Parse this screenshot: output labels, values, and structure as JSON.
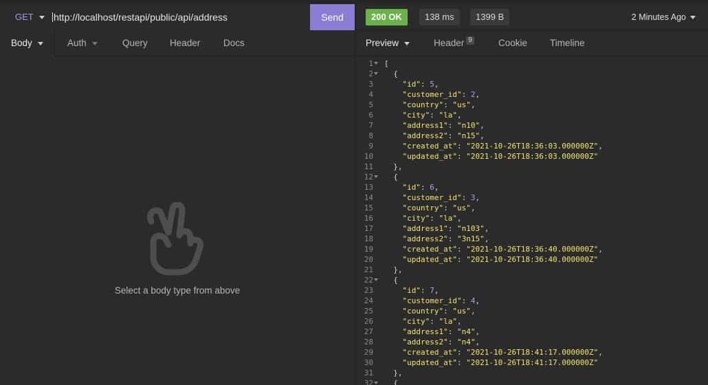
{
  "request": {
    "method": "GET",
    "url": "http://localhost/restapi/public/api/address",
    "send_label": "Send"
  },
  "response_meta": {
    "status": "200 OK",
    "time": "138 ms",
    "size": "1399 B",
    "ago": "2 Minutes Ago"
  },
  "left_tabs": {
    "body": "Body",
    "auth": "Auth",
    "query": "Query",
    "header": "Header",
    "docs": "Docs"
  },
  "left_body": {
    "empty_text": "Select a body type from above"
  },
  "right_tabs": {
    "preview": "Preview",
    "header": "Header",
    "header_count": "9",
    "cookie": "Cookie",
    "timeline": "Timeline"
  },
  "colors": {
    "send": "#8a7dd4",
    "status_ok": "#6bb24a",
    "json_string": "#f2e56b",
    "json_number": "#b49cf0"
  },
  "response_records": [
    {
      "id": 5,
      "customer_id": 2,
      "country": "us",
      "city": "la",
      "address1": "n10",
      "address2": "n15",
      "created_at": "2021-10-26T18:36:03.000000Z",
      "updated_at": "2021-10-26T18:36:03.000000Z"
    },
    {
      "id": 6,
      "customer_id": 3,
      "country": "us",
      "city": "la",
      "address1": "n103",
      "address2": "3n15",
      "created_at": "2021-10-26T18:36:40.000000Z",
      "updated_at": "2021-10-26T18:36:40.000000Z"
    },
    {
      "id": 7,
      "customer_id": 4,
      "country": "us",
      "city": "la",
      "address1": "n4",
      "address2": "n4",
      "created_at": "2021-10-26T18:41:17.000000Z",
      "updated_at": "2021-10-26T18:41:17.000000Z"
    }
  ]
}
